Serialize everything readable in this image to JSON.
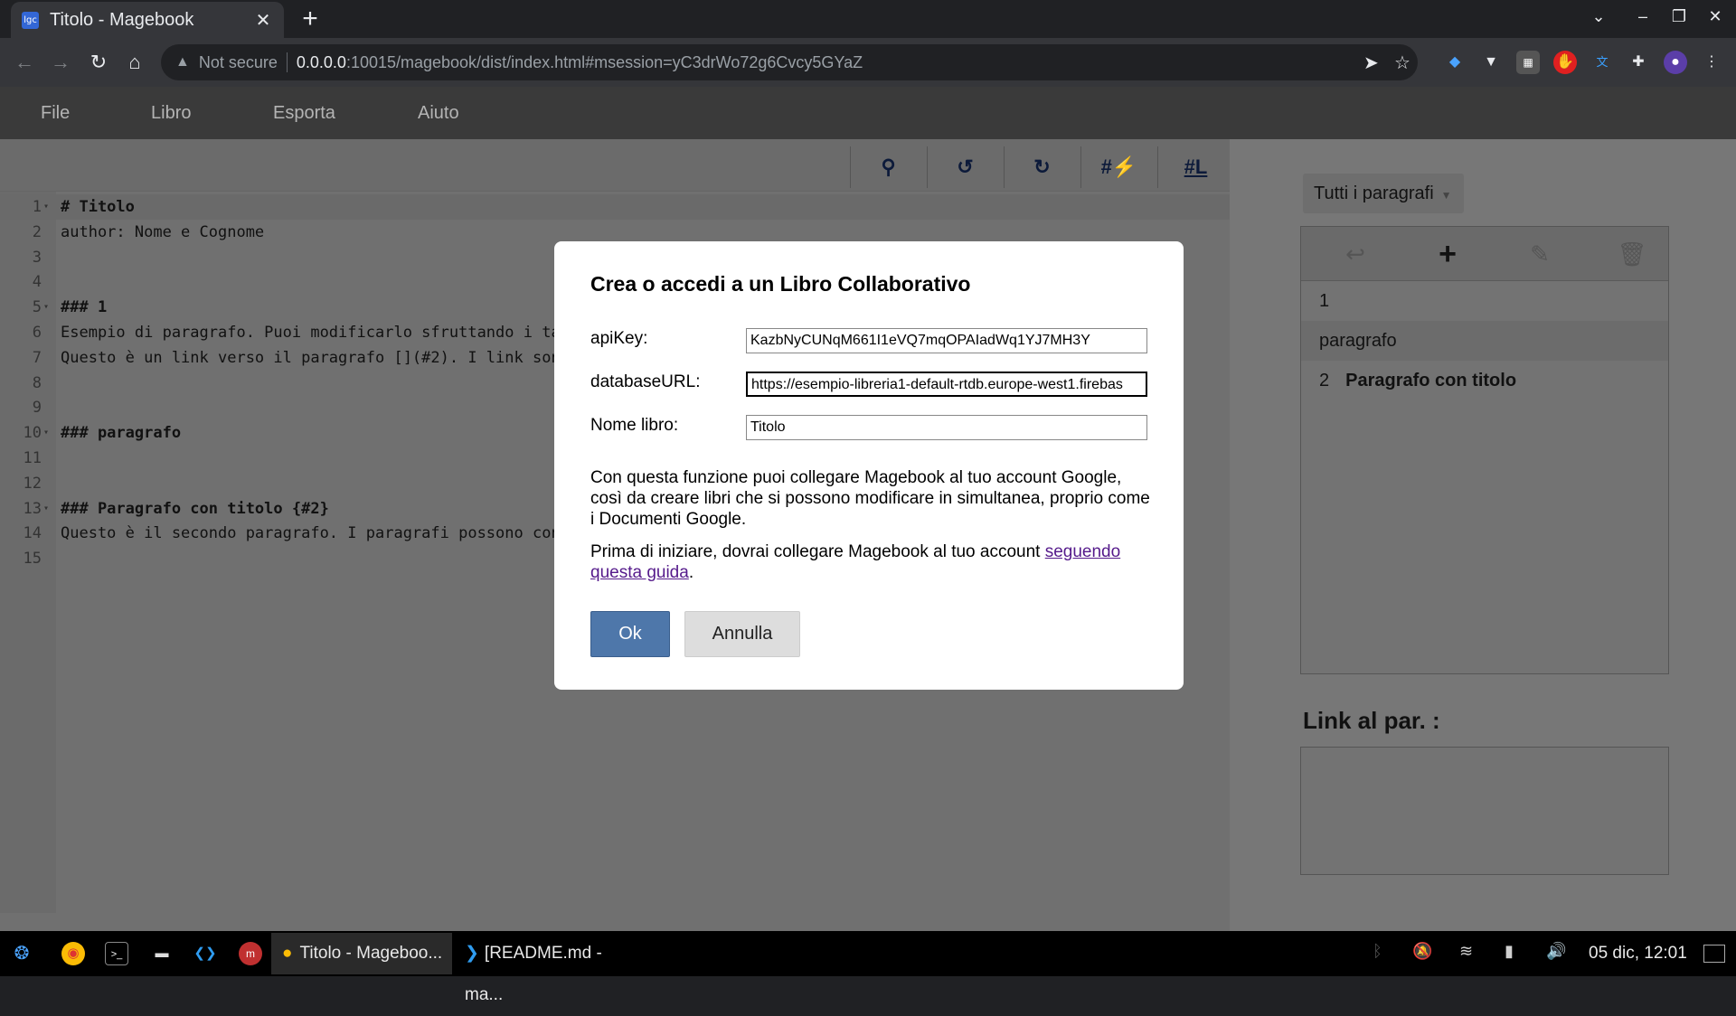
{
  "browser": {
    "tab_title": "Titolo - Magebook",
    "tab_favicon": "lgc",
    "security_label": "Not secure",
    "url_host": "0.0.0.0",
    "url_path": ":10015/magebook/dist/index.html#msession=yC3drWo72g6Cvcy5GYaZ"
  },
  "menu": {
    "file": "File",
    "libro": "Libro",
    "esporta": "Esporta",
    "aiuto": "Aiuto"
  },
  "editor": {
    "toolbar": {
      "hash_flash": "#⚡",
      "hash_l": "#L"
    },
    "lines": [
      {
        "num": "1",
        "text": "# Titolo"
      },
      {
        "num": "2",
        "text": "author: Nome e Cognome"
      },
      {
        "num": "3",
        "text": ""
      },
      {
        "num": "4",
        "text": ""
      },
      {
        "num": "5",
        "text": "### 1"
      },
      {
        "num": "6",
        "text": "Esempio di paragrafo. Puoi modificarlo sfruttando i ta"
      },
      {
        "num": "7",
        "text": "Questo è un link verso il paragrafo [](#2). I link son"
      },
      {
        "num": "8",
        "text": ""
      },
      {
        "num": "9",
        "text": ""
      },
      {
        "num": "10",
        "text": "### paragrafo"
      },
      {
        "num": "11",
        "text": ""
      },
      {
        "num": "12",
        "text": ""
      },
      {
        "num": "13",
        "text": "### Paragrafo con titolo {#2}"
      },
      {
        "num": "14",
        "text": "Questo è il secondo paragrafo. I paragrafi possono con"
      },
      {
        "num": "15",
        "text": ""
      }
    ]
  },
  "sidebar": {
    "filter_label": "Tutti i paragrafi",
    "paragraphs": [
      {
        "num": "1",
        "title": ""
      },
      {
        "num": "",
        "title": "paragrafo"
      },
      {
        "num": "2",
        "title": "Paragrafo con titolo"
      }
    ],
    "link_label": "Link al par. :"
  },
  "dialog": {
    "title": "Crea o accedi a un Libro Collaborativo",
    "apikey_label": "apiKey:",
    "apikey_value": "KazbNyCUNqM661I1eVQ7mqOPAIadWq1YJ7MH3Y",
    "dburl_label": "databaseURL:",
    "dburl_value": "https://esempio-libreria1-default-rtdb.europe-west1.firebas",
    "name_label": "Nome libro:",
    "name_value": "Titolo",
    "desc1": "Con questa funzione puoi collegare Magebook al tuo account Google, così da creare libri che si possono modificare in simultanea, proprio come i Documenti Google.",
    "desc2_prefix": "Prima di iniziare, dovrai collegare Magebook al tuo account ",
    "desc2_link": "seguendo questa guida",
    "desc2_suffix": ".",
    "ok_label": "Ok",
    "cancel_label": "Annulla"
  },
  "taskbar": {
    "windows": [
      {
        "label": "Titolo - Mageboo..."
      },
      {
        "label": "[README.md - ma..."
      }
    ],
    "clock": "05 dic, 12:01"
  },
  "colors": {
    "primary_button": "#4e77aa",
    "link": "#551a8b"
  }
}
